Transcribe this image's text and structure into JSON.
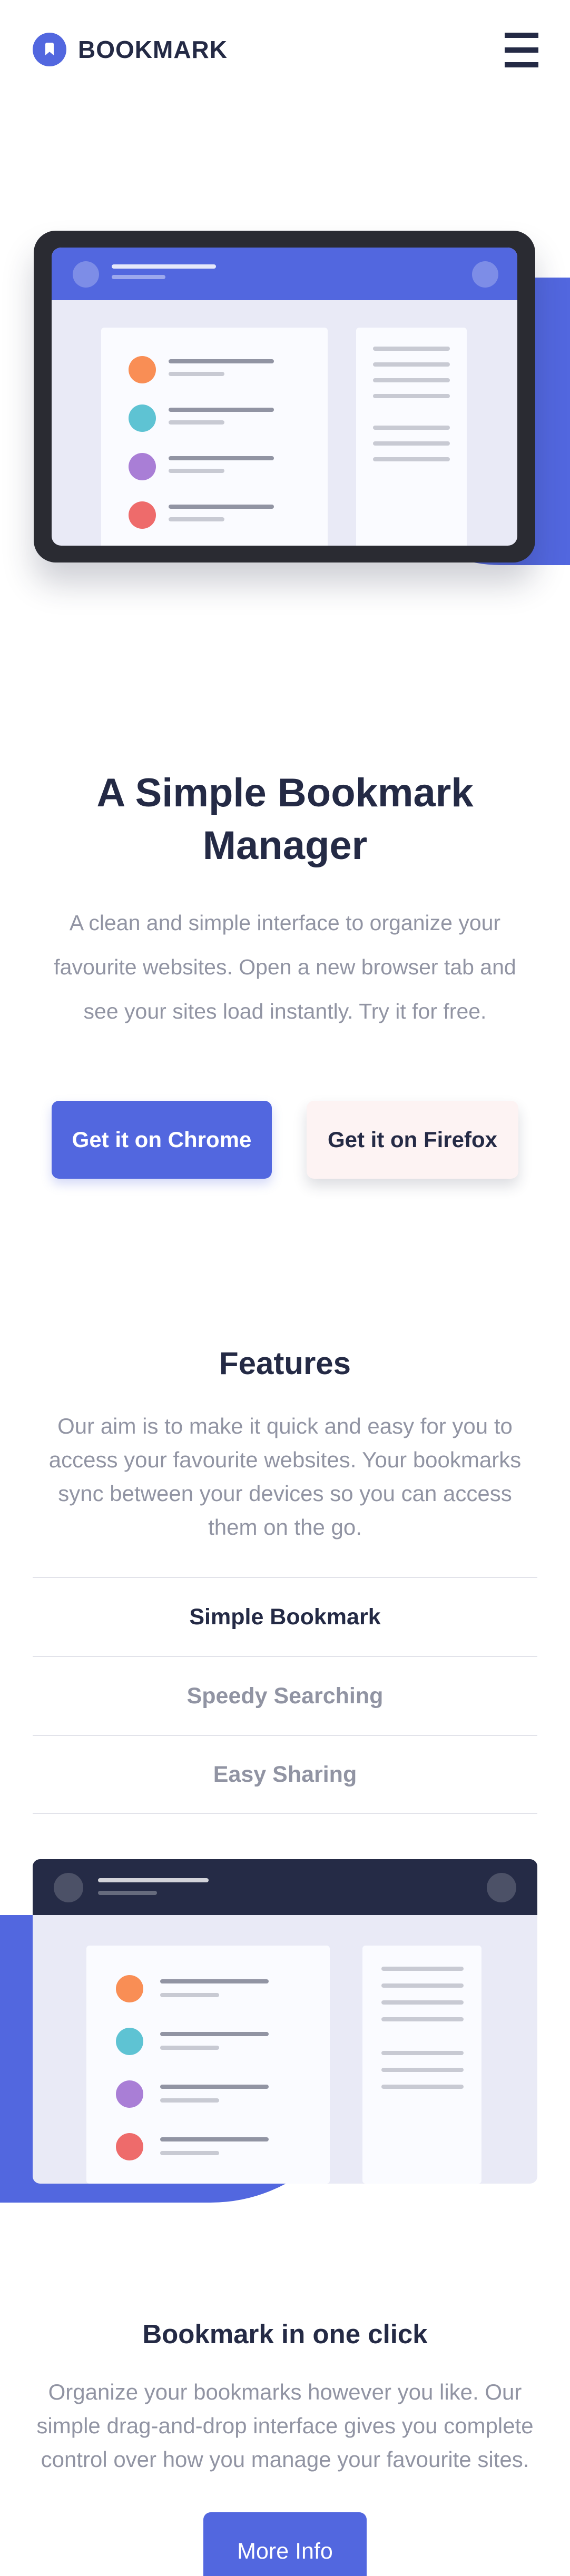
{
  "brand": {
    "name": "BOOKMARK",
    "accent_color": "#5267df",
    "dark_color": "#242a45",
    "soft_red_color": "#fa5959"
  },
  "header": {
    "menu_icon": "hamburger-icon"
  },
  "hero": {
    "title": "A Simple Bookmark Manager",
    "description": "A clean and simple interface to organize your favourite websites. Open a new browser tab and see your sites load instantly. Try it for free.",
    "chrome_button": "Get it on Chrome",
    "firefox_button": "Get it on Firefox"
  },
  "features": {
    "title": "Features",
    "description": "Our aim is to make it quick and easy for you to access your favourite websites. Your bookmarks sync between your devices so you can access them on the go.",
    "tabs": [
      {
        "label": "Simple Bookmark",
        "active": true
      },
      {
        "label": "Speedy Searching",
        "active": false
      },
      {
        "label": "Easy Sharing",
        "active": false
      }
    ]
  },
  "bookmark_section": {
    "title": "Bookmark in one click",
    "description": "Organize your bookmarks however you like. Our simple drag-and-drop interface gives you complete control over how you manage your favourite sites.",
    "button": "More Info"
  },
  "illustration_colors": [
    "#f98e55",
    "#5ec3d3",
    "#a97ed6",
    "#ee6b6b"
  ]
}
